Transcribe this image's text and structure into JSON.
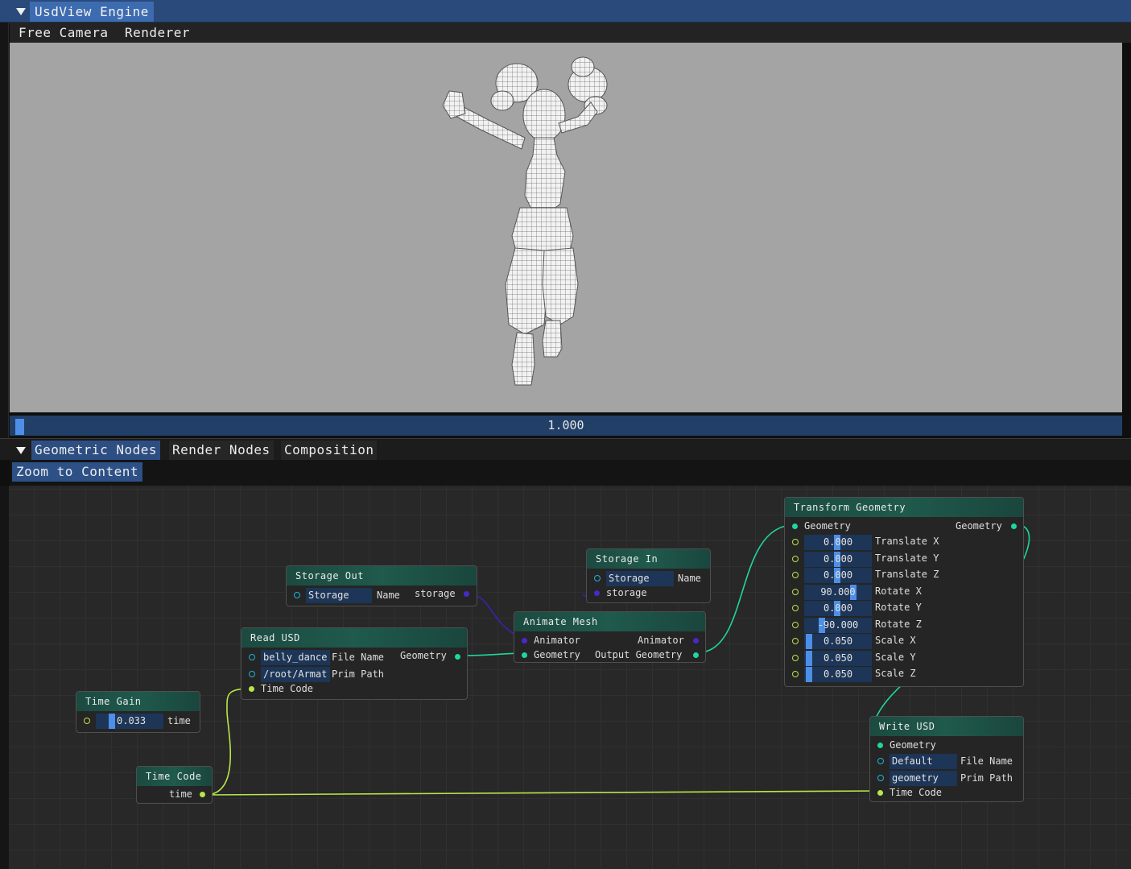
{
  "top_window": {
    "title": "UsdView Engine",
    "menu": [
      "Free Camera",
      "Renderer"
    ],
    "timeline_value": "1.000",
    "timeline_progress": 0.0
  },
  "bottom_window": {
    "tabs": [
      "Geometric Nodes",
      "Render Nodes",
      "Composition"
    ],
    "active_tab": "Geometric Nodes",
    "zoom_button": "Zoom to Content"
  },
  "nodes": {
    "storage_out": {
      "title": "Storage Out",
      "field": "Storage",
      "field_label": "Name",
      "output": "storage"
    },
    "storage_in": {
      "title": "Storage In",
      "field": "Storage",
      "field_label": "Name",
      "input": "storage"
    },
    "read_usd": {
      "title": "Read USD",
      "file_value": "belly_dance",
      "file_label": "File Name",
      "output": "Geometry",
      "prim_value": "/root/Armat",
      "prim_label": "Prim Path",
      "time_input": "Time Code"
    },
    "animate_mesh": {
      "title": "Animate Mesh",
      "in_animator": "Animator",
      "out_animator": "Animator",
      "in_geometry": "Geometry",
      "out_geometry": "Output Geometry"
    },
    "transform_geometry": {
      "title": "Transform Geometry",
      "in_geometry": "Geometry",
      "out_geometry": "Geometry",
      "params": [
        {
          "value": "0.000",
          "label": "Translate X"
        },
        {
          "value": "0.000",
          "label": "Translate Y"
        },
        {
          "value": "0.000",
          "label": "Translate Z"
        },
        {
          "value": "90.000",
          "label": "Rotate X"
        },
        {
          "value": "0.000",
          "label": "Rotate Y"
        },
        {
          "value": "-90.000",
          "label": "Rotate Z"
        },
        {
          "value": "0.050",
          "label": "Scale X"
        },
        {
          "value": "0.050",
          "label": "Scale Y"
        },
        {
          "value": "0.050",
          "label": "Scale Z"
        }
      ]
    },
    "time_gain": {
      "title": "Time Gain",
      "value": "0.033",
      "label": "time"
    },
    "time_code": {
      "title": "Time Code",
      "output": "time"
    },
    "write_usd": {
      "title": "Write USD",
      "in_geometry": "Geometry",
      "file_value": "Default",
      "file_label": "File Name",
      "prim_value": "geometry",
      "prim_label": "Prim Path",
      "time_input": "Time Code"
    }
  },
  "colors": {
    "title_bar": "#294a7a",
    "active_tab": "#3d6bb0",
    "node_header": "#1f5a4c",
    "geometry_wire": "#1fd6a0",
    "time_wire": "#b9e64a",
    "storage_wire": "#4a28c8"
  }
}
